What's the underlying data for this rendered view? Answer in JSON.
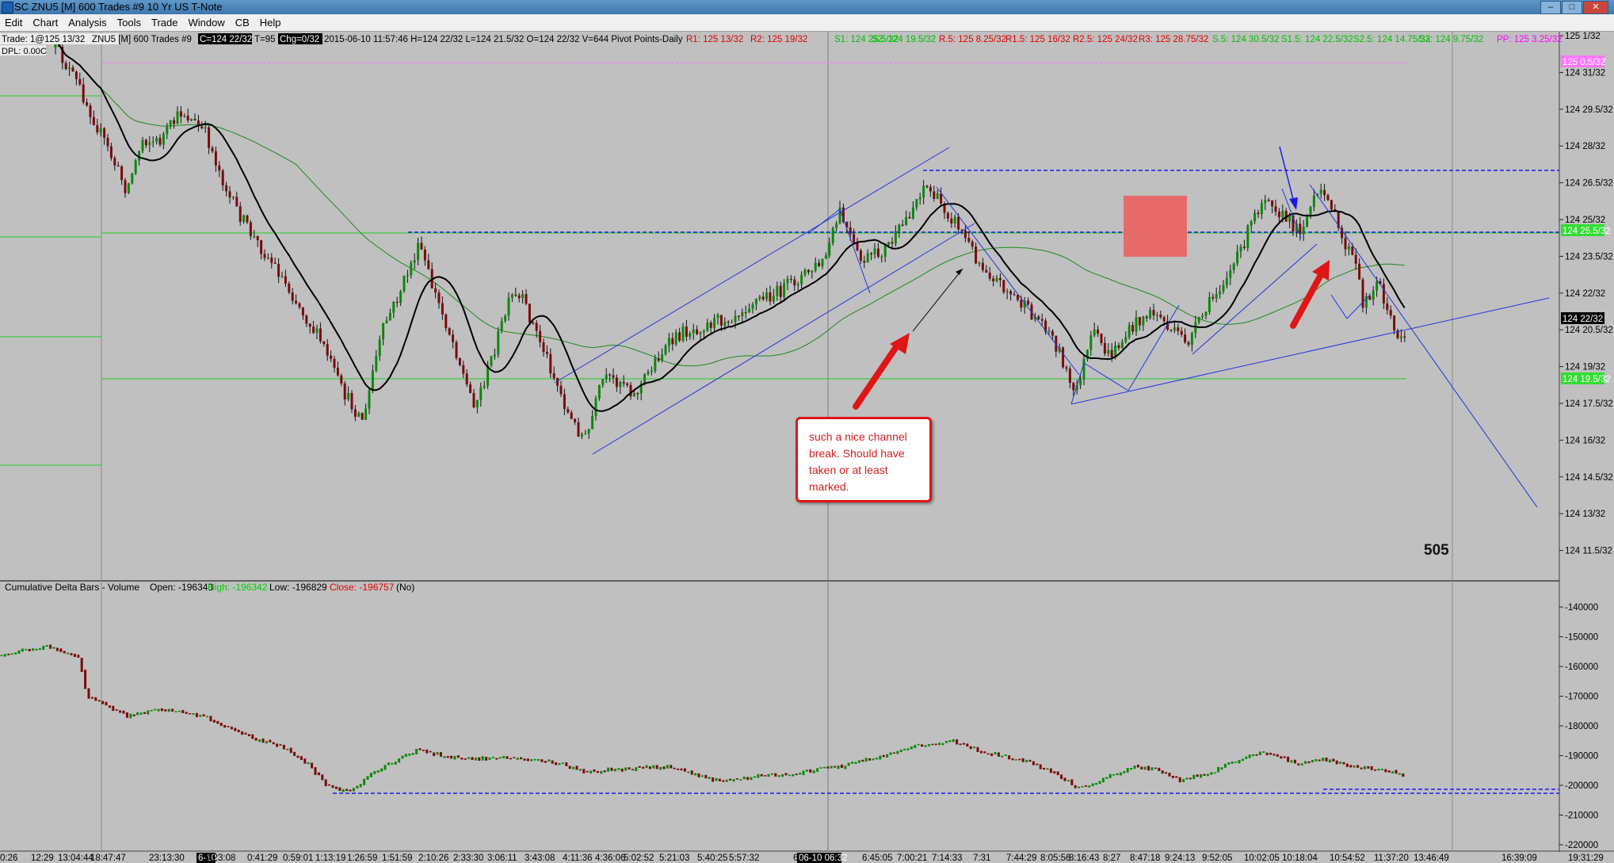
{
  "window": {
    "title": "SC ZNU5 [M]  600 Trades  #9  10 Yr US T-Note",
    "minimize": "–",
    "maximize": "□",
    "close": "✕"
  },
  "menu": [
    "Edit",
    "Chart",
    "Analysis",
    "Tools",
    "Trade",
    "Window",
    "CB",
    "Help"
  ],
  "header": {
    "trade_label": "Trade: 1@125 13/32",
    "symbol_info": "ZNU5 [M] 600 Trades #9",
    "last_highlight": "C=124 22/32",
    "t_value": "T=95",
    "chg_highlight": "Chg=0/32",
    "stats": "2015-06-10 11:57:46 H=124 22/32 L=124 21.5/32 O=124 22/32 V=644 Pivot Points-Daily",
    "dpl": "DPL: 0.00C",
    "pivots": [
      {
        "text": "R1: 125 13/32",
        "color": "#e00000"
      },
      {
        "text": "R2: 125 19/32",
        "color": "#e00000"
      },
      {
        "text": "S1: 124 25.5/32",
        "color": "#00c000"
      },
      {
        "text": "S2: 124 19.5/32",
        "color": "#00c000"
      },
      {
        "text": "R.5: 125 8.25/32",
        "color": "#e00000"
      },
      {
        "text": "R1.5: 125 16/32",
        "color": "#e00000"
      },
      {
        "text": "R2.5: 125 24/32",
        "color": "#e00000"
      },
      {
        "text": "R3: 125 28.75/32",
        "color": "#e00000"
      },
      {
        "text": "S.5: 124 30.5/32",
        "color": "#00c000"
      },
      {
        "text": "S1.5: 124 22.5/32",
        "color": "#00c000"
      },
      {
        "text": "S2.5: 124 14.75/32",
        "color": "#00c000"
      },
      {
        "text": "S3: 124 9.75/32",
        "color": "#00c000"
      },
      {
        "text": "PP: 125 3.25/32",
        "color": "#ff00ff"
      }
    ]
  },
  "price_axis": {
    "ticks": [
      "125 1/32",
      "124 31/32",
      "124 29.5/32",
      "124 28/32",
      "124 26.5/32",
      "124 25/32",
      "124 23.5/32",
      "124 22/32",
      "124 20.5/32",
      "124 19/32",
      "124 17.5/32",
      "124 16/32",
      "124 14.5/32",
      "124 13/32",
      "124 11.5/32"
    ],
    "markers": [
      {
        "text": "125 0.5/32",
        "bg": "#ff77ff",
        "fg": "#ffffff"
      },
      {
        "text": "124 25.5/32",
        "bg": "#33dd33",
        "fg": "#ffffff"
      },
      {
        "text": "124 22/32",
        "bg": "#000000",
        "fg": "#ffffff"
      },
      {
        "text": "124 19.5/32",
        "bg": "#33dd33",
        "fg": "#ffffff"
      }
    ]
  },
  "bar_count": "505",
  "callout": {
    "text": "such a nice channel break.  Should have taken or at least marked.",
    "border_color": "#e01515"
  },
  "delta_panel": {
    "study": "Cumulative Delta Bars - Volume",
    "open": "Open: -196343",
    "high": "High: -196342",
    "low": "Low: -196829",
    "close": "Close: -196757",
    "mode": "(No)",
    "ticks": [
      "-140000",
      "-150000",
      "-160000",
      "-170000",
      "-180000",
      "-190000",
      "-200000",
      "-210000",
      "-220000"
    ]
  },
  "time_axis": {
    "labels": [
      "0:26",
      "12:29",
      "13:04:44",
      "18:47:47",
      "23:13:30",
      "6-10",
      "0:23:08",
      "0:41:29",
      "0:59:01",
      "1:13:19",
      "1:26:59",
      "1:51:59",
      "2:10:26",
      "2:33:30",
      "3:06:11",
      "3:43:08",
      "4:11:36",
      "4:36:06",
      "5:02:52",
      "5:21:03",
      "5:40:25",
      "5:57:32",
      "6",
      "06-10  06:32",
      "6:45:05",
      "7:00:21",
      "7:14:33",
      "7:31",
      "7:44:29",
      "8:05:56",
      "8:16:43",
      "8:27",
      "8:47:18",
      "9:24:13",
      "9:52:05",
      "10:02:05",
      "10:18:04",
      "10:54:52",
      "11:37:20",
      "13:46:49",
      "16:39:09",
      "19:31:29"
    ]
  }
}
